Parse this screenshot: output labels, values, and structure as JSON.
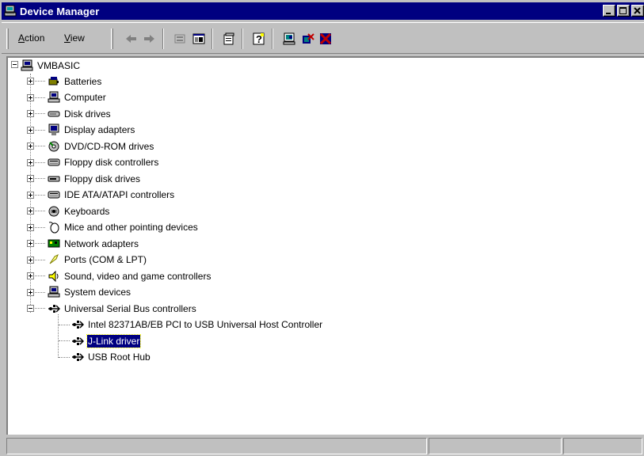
{
  "window": {
    "title": "Device Manager",
    "title_bar_color": "#000080"
  },
  "toolbar": {
    "menus": [
      {
        "label": "Action",
        "accel": "A",
        "rest": "ction"
      },
      {
        "label": "View",
        "accel": "V",
        "rest": "iew"
      }
    ],
    "buttons": [
      "back-arrow-icon",
      "forward-arrow-icon",
      "up-level-icon",
      "show-hide-tree-icon",
      "properties-icon",
      "help-icon",
      "scan-hardware-icon",
      "uninstall-icon",
      "disable-icon"
    ]
  },
  "tree": {
    "root": "VMBASIC",
    "categories": [
      "Batteries",
      "Computer",
      "Disk drives",
      "Display adapters",
      "DVD/CD-ROM drives",
      "Floppy disk controllers",
      "Floppy disk drives",
      "IDE ATA/ATAPI controllers",
      "Keyboards",
      "Mice and other pointing devices",
      "Network adapters",
      "Ports (COM & LPT)",
      "Sound, video and game controllers",
      "System devices",
      "Universal Serial Bus controllers"
    ],
    "usb_children": [
      "Intel 82371AB/EB PCI to USB Universal Host Controller",
      "J-Link driver",
      "USB Root Hub"
    ],
    "selected": "J-Link driver"
  },
  "statusbar": {
    "panes": [
      "",
      "",
      ""
    ]
  }
}
